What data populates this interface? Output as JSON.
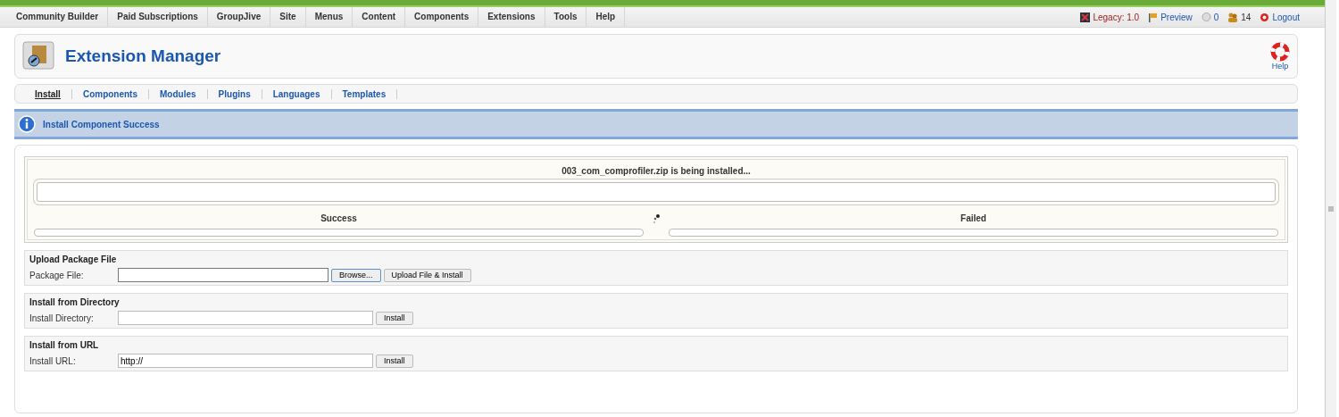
{
  "menu": {
    "items": [
      "Community Builder",
      "Paid Subscriptions",
      "GroupJive",
      "Site",
      "Menus",
      "Content",
      "Components",
      "Extensions",
      "Tools",
      "Help"
    ],
    "status": [
      {
        "kind": "legacy",
        "label": "Legacy: 1.0"
      },
      {
        "kind": "preview",
        "label": "Preview"
      },
      {
        "kind": "messages",
        "label": "0"
      },
      {
        "kind": "users",
        "label": "14"
      },
      {
        "kind": "logout",
        "label": "Logout"
      }
    ]
  },
  "header": {
    "title": "Extension Manager",
    "help": "Help"
  },
  "tabs": [
    {
      "label": "Install",
      "selected": true
    },
    {
      "label": "Components",
      "selected": false
    },
    {
      "label": "Modules",
      "selected": false
    },
    {
      "label": "Plugins",
      "selected": false
    },
    {
      "label": "Languages",
      "selected": false
    },
    {
      "label": "Templates",
      "selected": false
    }
  ],
  "message": "Install Component Success",
  "progress": {
    "title": "003_com_comprofiler.zip is being installed...",
    "level": 0,
    "success": {
      "label": "Success",
      "level": 0
    },
    "failed": {
      "label": "Failed",
      "level": 0
    }
  },
  "sections": [
    {
      "kind": "file",
      "title": "Upload Package File",
      "label": "Package File:",
      "browse": "Browse...",
      "button": "Upload File & Install"
    },
    {
      "kind": "text",
      "title": "Install from Directory",
      "label": "Install Directory:",
      "button": "Install"
    },
    {
      "kind": "text",
      "title": "Install from URL",
      "label": "Install URL:",
      "value": "http://",
      "button": "Install"
    }
  ]
}
